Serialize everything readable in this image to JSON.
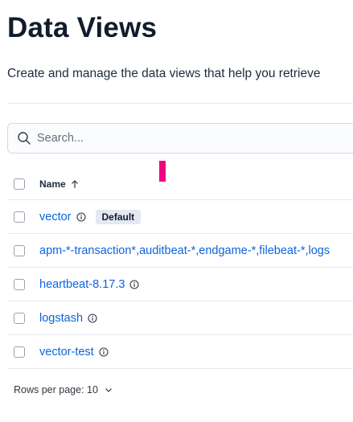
{
  "page": {
    "title": "Data Views",
    "description": "Create and manage the data views that help you retrieve"
  },
  "search": {
    "placeholder": "Search..."
  },
  "table": {
    "header": {
      "name_label": "Name"
    },
    "rows": [
      {
        "name": "vector",
        "badge": "Default"
      },
      {
        "name": "apm-*-transaction*,auditbeat-*,endgame-*,filebeat-*,logs"
      },
      {
        "name": "heartbeat-8.17.3"
      },
      {
        "name": "logstash"
      },
      {
        "name": "vector-test"
      }
    ]
  },
  "pagination": {
    "rows_per_page_label": "Rows per page: 10"
  },
  "colors": {
    "link": "#0b64dd",
    "marker": "#f0047f",
    "badge_bg": "#e3e8f2",
    "border": "#e3e8f2"
  }
}
